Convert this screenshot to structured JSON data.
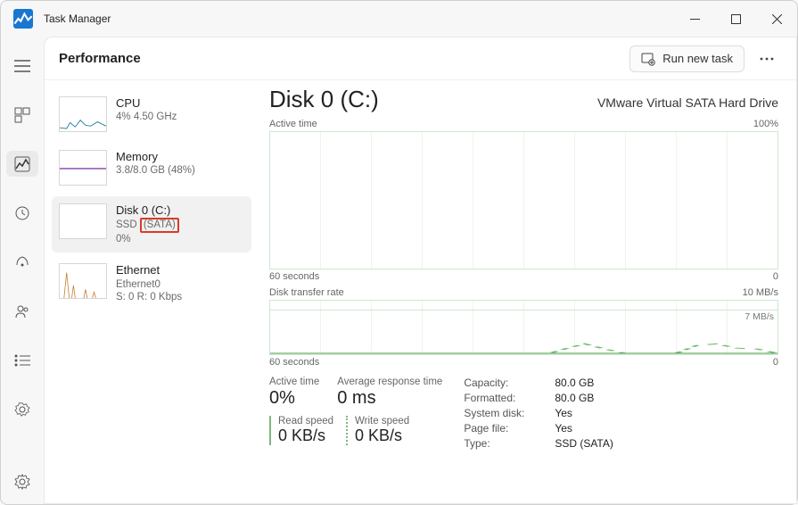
{
  "app": {
    "title": "Task Manager"
  },
  "header": {
    "page_title": "Performance",
    "run_task": "Run new task"
  },
  "sidebar": {
    "items": [
      {
        "name": "CPU",
        "sub": "4% 4.50 GHz"
      },
      {
        "name": "Memory",
        "sub": "3.8/8.0 GB (48%)"
      },
      {
        "name": "Disk 0 (C:)",
        "sub_prefix": "SSD ",
        "sub_highlight": "(SATA)",
        "sub2": "0%"
      },
      {
        "name": "Ethernet",
        "sub": "Ethernet0",
        "sub2": "S: 0 R: 0 Kbps"
      }
    ]
  },
  "detail": {
    "title": "Disk 0 (C:)",
    "model": "VMware Virtual SATA Hard Drive",
    "chart1": {
      "label": "Active time",
      "max": "100%",
      "x_left": "60 seconds",
      "x_right": "0"
    },
    "chart2": {
      "label": "Disk transfer rate",
      "max": "10 MB/s",
      "baseline": "7 MB/s",
      "x_left": "60 seconds",
      "x_right": "0"
    },
    "stats": {
      "active_time": {
        "label": "Active time",
        "value": "0%"
      },
      "avg_response": {
        "label": "Average response time",
        "value": "0 ms"
      },
      "read": {
        "label": "Read speed",
        "value": "0 KB/s"
      },
      "write": {
        "label": "Write speed",
        "value": "0 KB/s"
      },
      "kv": {
        "capacity_l": "Capacity:",
        "capacity_v": "80.0 GB",
        "formatted_l": "Formatted:",
        "formatted_v": "80.0 GB",
        "system_l": "System disk:",
        "system_v": "Yes",
        "pagefile_l": "Page file:",
        "pagefile_v": "Yes",
        "type_l": "Type:",
        "type_v": "SSD (SATA)"
      }
    }
  },
  "chart_data": [
    {
      "type": "line",
      "title": "Active time",
      "ylabel": "%",
      "ylim": [
        0,
        100
      ],
      "x_seconds": 60,
      "values": [
        0,
        0,
        0,
        0,
        0,
        0,
        0,
        0,
        0,
        0,
        0,
        0,
        0,
        0,
        0,
        0,
        0,
        0,
        0,
        0,
        0,
        0,
        0,
        0,
        0,
        0,
        0,
        0,
        0,
        0
      ]
    },
    {
      "type": "line",
      "title": "Disk transfer rate",
      "ylabel": "MB/s",
      "ylim": [
        0,
        10
      ],
      "x_seconds": 60,
      "series": [
        {
          "name": "Read",
          "values": [
            0,
            0,
            0,
            0,
            0,
            0,
            0,
            0,
            0,
            0,
            0,
            0,
            0,
            0,
            0,
            0,
            0,
            0,
            0,
            0,
            0,
            0,
            0,
            0,
            0,
            0,
            0,
            0,
            0,
            0
          ]
        },
        {
          "name": "Write",
          "values": [
            0,
            0,
            0,
            0,
            0,
            0,
            0,
            0,
            0,
            0,
            0,
            0,
            0,
            0,
            0,
            0,
            0,
            1,
            2,
            1,
            0,
            0,
            0,
            0,
            0,
            2,
            2,
            1,
            1,
            0
          ]
        }
      ]
    }
  ]
}
